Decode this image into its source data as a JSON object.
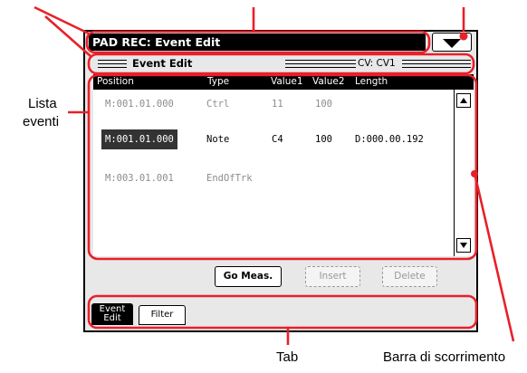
{
  "window": {
    "title": "PAD REC: Event Edit"
  },
  "page": {
    "title": "Event Edit",
    "cv_label": "CV: CV1"
  },
  "columns": [
    "Position",
    "Type",
    "Value1",
    "Value2",
    "Length"
  ],
  "events": [
    {
      "position": "M:001.01.000",
      "type": "Ctrl",
      "value1": "11",
      "value2": "100",
      "length": "",
      "state": "dim"
    },
    {
      "position": "M:001.01.000",
      "type": "Note",
      "value1": "C4",
      "value2": "100",
      "length": "D:000.00.192",
      "state": "selected"
    },
    {
      "position": "M:003.01.001",
      "type": "EndOfTrk",
      "value1": "",
      "value2": "",
      "length": "",
      "state": "dim"
    }
  ],
  "buttons": {
    "go_meas": "Go Meas.",
    "insert": "Insert",
    "delete": "Delete"
  },
  "tabs": {
    "event_edit_line1": "Event",
    "event_edit_line2": "Edit",
    "filter": "Filter"
  },
  "callouts": {
    "event_list_line1": "Lista",
    "event_list_line2": "eventi",
    "tab": "Tab",
    "scrollbar": "Barra di scorrimento"
  },
  "icons": {
    "menu": "page-menu-icon",
    "scroll_up": "scroll-up-icon",
    "scroll_down": "scroll-down-icon"
  }
}
